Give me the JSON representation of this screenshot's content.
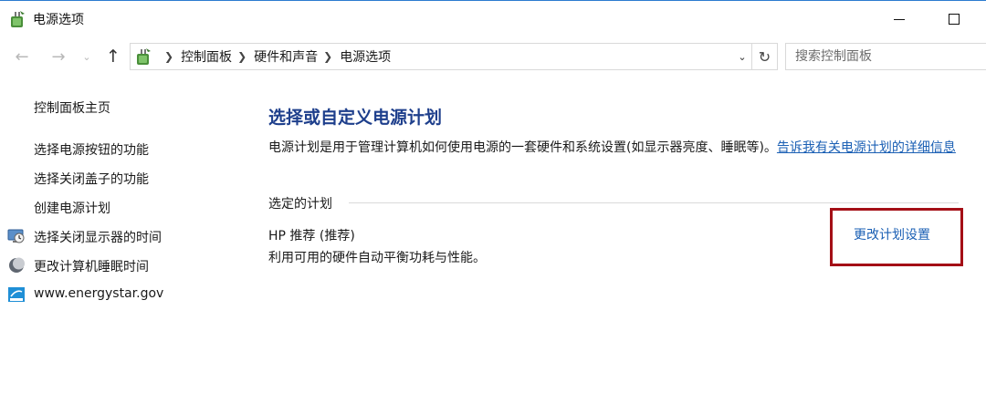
{
  "window": {
    "title": "电源选项"
  },
  "navigation": {
    "back_icon": "arrow-left-icon",
    "forward_icon": "arrow-right-icon",
    "up_icon": "arrow-up-icon",
    "breadcrumbs": [
      "控制面板",
      "硬件和声音",
      "电源选项"
    ]
  },
  "search": {
    "placeholder": "搜索控制面板"
  },
  "sidebar": {
    "home_label": "控制面板主页",
    "links": [
      "选择电源按钮的功能",
      "选择关闭盖子的功能",
      "创建电源计划"
    ],
    "icon_links": [
      {
        "label": "选择关闭显示器的时间",
        "icon": "monitor-clock-icon"
      },
      {
        "label": "更改计算机睡眠时间",
        "icon": "moon-icon"
      },
      {
        "label": "www.energystar.gov",
        "icon": "energy-star-icon"
      }
    ]
  },
  "main": {
    "heading": "选择或自定义电源计划",
    "description": "电源计划是用于管理计算机如何使用电源的一套硬件和系统设置(如显示器亮度、睡眠等)。",
    "description_link": "告诉我有关电源计划的详细信息",
    "group_label": "选定的计划",
    "plan": {
      "name": "HP 推荐 (推荐)",
      "description": "利用可用的硬件自动平衡功耗与性能。",
      "change_link": "更改计划设置"
    }
  },
  "colors": {
    "heading": "#1e3f8c",
    "link": "#1a5fb4",
    "highlight": "#a40f16"
  }
}
